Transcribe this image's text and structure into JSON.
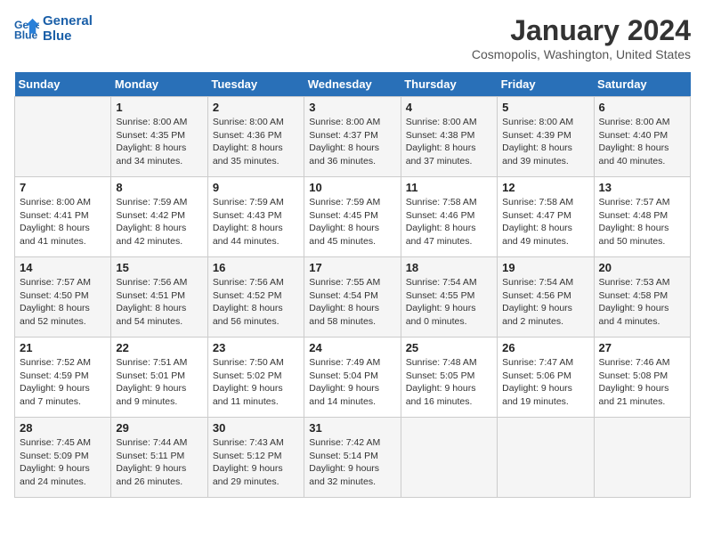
{
  "header": {
    "logo_line1": "General",
    "logo_line2": "Blue",
    "month": "January 2024",
    "location": "Cosmopolis, Washington, United States"
  },
  "days_of_week": [
    "Sunday",
    "Monday",
    "Tuesday",
    "Wednesday",
    "Thursday",
    "Friday",
    "Saturday"
  ],
  "weeks": [
    [
      {
        "day": "",
        "info": ""
      },
      {
        "day": "1",
        "info": "Sunrise: 8:00 AM\nSunset: 4:35 PM\nDaylight: 8 hours\nand 34 minutes."
      },
      {
        "day": "2",
        "info": "Sunrise: 8:00 AM\nSunset: 4:36 PM\nDaylight: 8 hours\nand 35 minutes."
      },
      {
        "day": "3",
        "info": "Sunrise: 8:00 AM\nSunset: 4:37 PM\nDaylight: 8 hours\nand 36 minutes."
      },
      {
        "day": "4",
        "info": "Sunrise: 8:00 AM\nSunset: 4:38 PM\nDaylight: 8 hours\nand 37 minutes."
      },
      {
        "day": "5",
        "info": "Sunrise: 8:00 AM\nSunset: 4:39 PM\nDaylight: 8 hours\nand 39 minutes."
      },
      {
        "day": "6",
        "info": "Sunrise: 8:00 AM\nSunset: 4:40 PM\nDaylight: 8 hours\nand 40 minutes."
      }
    ],
    [
      {
        "day": "7",
        "info": "Sunrise: 8:00 AM\nSunset: 4:41 PM\nDaylight: 8 hours\nand 41 minutes."
      },
      {
        "day": "8",
        "info": "Sunrise: 7:59 AM\nSunset: 4:42 PM\nDaylight: 8 hours\nand 42 minutes."
      },
      {
        "day": "9",
        "info": "Sunrise: 7:59 AM\nSunset: 4:43 PM\nDaylight: 8 hours\nand 44 minutes."
      },
      {
        "day": "10",
        "info": "Sunrise: 7:59 AM\nSunset: 4:45 PM\nDaylight: 8 hours\nand 45 minutes."
      },
      {
        "day": "11",
        "info": "Sunrise: 7:58 AM\nSunset: 4:46 PM\nDaylight: 8 hours\nand 47 minutes."
      },
      {
        "day": "12",
        "info": "Sunrise: 7:58 AM\nSunset: 4:47 PM\nDaylight: 8 hours\nand 49 minutes."
      },
      {
        "day": "13",
        "info": "Sunrise: 7:57 AM\nSunset: 4:48 PM\nDaylight: 8 hours\nand 50 minutes."
      }
    ],
    [
      {
        "day": "14",
        "info": "Sunrise: 7:57 AM\nSunset: 4:50 PM\nDaylight: 8 hours\nand 52 minutes."
      },
      {
        "day": "15",
        "info": "Sunrise: 7:56 AM\nSunset: 4:51 PM\nDaylight: 8 hours\nand 54 minutes."
      },
      {
        "day": "16",
        "info": "Sunrise: 7:56 AM\nSunset: 4:52 PM\nDaylight: 8 hours\nand 56 minutes."
      },
      {
        "day": "17",
        "info": "Sunrise: 7:55 AM\nSunset: 4:54 PM\nDaylight: 8 hours\nand 58 minutes."
      },
      {
        "day": "18",
        "info": "Sunrise: 7:54 AM\nSunset: 4:55 PM\nDaylight: 9 hours\nand 0 minutes."
      },
      {
        "day": "19",
        "info": "Sunrise: 7:54 AM\nSunset: 4:56 PM\nDaylight: 9 hours\nand 2 minutes."
      },
      {
        "day": "20",
        "info": "Sunrise: 7:53 AM\nSunset: 4:58 PM\nDaylight: 9 hours\nand 4 minutes."
      }
    ],
    [
      {
        "day": "21",
        "info": "Sunrise: 7:52 AM\nSunset: 4:59 PM\nDaylight: 9 hours\nand 7 minutes."
      },
      {
        "day": "22",
        "info": "Sunrise: 7:51 AM\nSunset: 5:01 PM\nDaylight: 9 hours\nand 9 minutes."
      },
      {
        "day": "23",
        "info": "Sunrise: 7:50 AM\nSunset: 5:02 PM\nDaylight: 9 hours\nand 11 minutes."
      },
      {
        "day": "24",
        "info": "Sunrise: 7:49 AM\nSunset: 5:04 PM\nDaylight: 9 hours\nand 14 minutes."
      },
      {
        "day": "25",
        "info": "Sunrise: 7:48 AM\nSunset: 5:05 PM\nDaylight: 9 hours\nand 16 minutes."
      },
      {
        "day": "26",
        "info": "Sunrise: 7:47 AM\nSunset: 5:06 PM\nDaylight: 9 hours\nand 19 minutes."
      },
      {
        "day": "27",
        "info": "Sunrise: 7:46 AM\nSunset: 5:08 PM\nDaylight: 9 hours\nand 21 minutes."
      }
    ],
    [
      {
        "day": "28",
        "info": "Sunrise: 7:45 AM\nSunset: 5:09 PM\nDaylight: 9 hours\nand 24 minutes."
      },
      {
        "day": "29",
        "info": "Sunrise: 7:44 AM\nSunset: 5:11 PM\nDaylight: 9 hours\nand 26 minutes."
      },
      {
        "day": "30",
        "info": "Sunrise: 7:43 AM\nSunset: 5:12 PM\nDaylight: 9 hours\nand 29 minutes."
      },
      {
        "day": "31",
        "info": "Sunrise: 7:42 AM\nSunset: 5:14 PM\nDaylight: 9 hours\nand 32 minutes."
      },
      {
        "day": "",
        "info": ""
      },
      {
        "day": "",
        "info": ""
      },
      {
        "day": "",
        "info": ""
      }
    ]
  ]
}
